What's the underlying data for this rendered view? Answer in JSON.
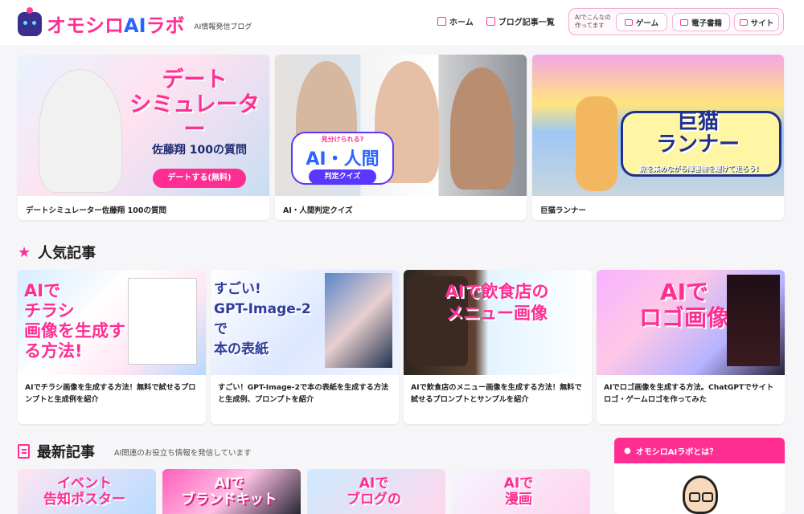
{
  "brand": {
    "name_part1": "オモシロ",
    "name_ai": "AI",
    "name_part2": "ラボ",
    "sub": "AI情報発信ブログ"
  },
  "nav": {
    "items": [
      "ホーム",
      "ブログ記事一覧"
    ]
  },
  "made_box": {
    "label": "AIでこんなの作ってます",
    "items": [
      "ゲーム",
      "電子書籍",
      "サイト"
    ]
  },
  "featured": [
    {
      "overlay": "デート\nシミュレーター",
      "sub": "佐藤翔 100の質問",
      "button": "デートする(無料)",
      "caption": "デートシミュレーター佐藤翔 100の質問"
    },
    {
      "overlay": "AI・人間",
      "sub": "見分けられる?",
      "button": "判定クイズ",
      "caption": "AI・人間判定クイズ"
    },
    {
      "overlay": "巨猫\nランナー",
      "sub": "魚を集めながら障害物を避けて走ろう!",
      "caption": "巨猫ランナー"
    }
  ],
  "popular": {
    "title": "人気記事",
    "items": [
      {
        "overlay": "AIで\nチラシ\n画像を生成する方法!",
        "caption": "AIでチラシ画像を生成する方法！無料で試せるプロンプトと生成例を紹介"
      },
      {
        "overlay": "すごい!\nGPT-Image-2で\n本の表紙",
        "caption": "すごい！GPT-Image-2で本の表紙を生成する方法と生成例、プロンプトを紹介"
      },
      {
        "overlay": "AIで飲食店の\nメニュー画像",
        "caption": "AIで飲食店のメニュー画像を生成する方法！無料で試せるプロンプトとサンプルを紹介"
      },
      {
        "overlay": "AIで\nロゴ画像",
        "caption": "AIでロゴ画像を生成する方法。ChatGPTでサイトロゴ・ゲームロゴを作ってみた"
      }
    ]
  },
  "latest": {
    "title": "最新記事",
    "subtitle": "AI関連のお役立ち情報を発信しています",
    "items": [
      {
        "overlay": "イベント\n告知ポスター"
      },
      {
        "overlay": "AIで\nブランドキット"
      },
      {
        "overlay": "AIで\nブログの"
      },
      {
        "overlay": "AIで\n漫画"
      }
    ]
  },
  "side": {
    "title": "オモシロAIラボとは？"
  }
}
